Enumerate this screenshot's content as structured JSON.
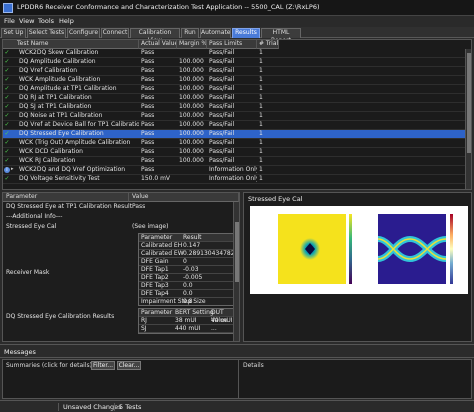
{
  "window": {
    "title": "LPDDR6 Receiver Conformance and Characterization Test Application -- 5500_CAL  (Z:\\RxLP6)"
  },
  "menu": [
    "File",
    "View",
    "Tools",
    "Help"
  ],
  "tabs": [
    {
      "label": "Set Up",
      "active": false
    },
    {
      "label": "Select Tests",
      "active": false
    },
    {
      "label": "Configure",
      "active": false
    },
    {
      "label": "Connect",
      "active": false
    },
    {
      "label": "Calibration View",
      "active": false
    },
    {
      "label": "Run",
      "active": false
    },
    {
      "label": "Automate",
      "active": false
    },
    {
      "label": "Results",
      "active": true
    },
    {
      "label": "HTML Report",
      "active": false
    }
  ],
  "results": {
    "columns": [
      "Test Name",
      "Actual Value",
      "Margin %",
      "Pass Limits",
      "# Trials"
    ],
    "rows": [
      {
        "icon": "check",
        "name": "WCK2DQ Skew Calibration",
        "actual": "Pass",
        "margin": "",
        "limits": "Pass/Fail",
        "trials": "1",
        "selected": false
      },
      {
        "icon": "check",
        "name": "DQ Amplitude Calibration",
        "actual": "Pass",
        "margin": "100.000",
        "limits": "Pass/Fail",
        "trials": "1",
        "selected": false
      },
      {
        "icon": "check",
        "name": "DQ Vref Calibration",
        "actual": "Pass",
        "margin": "100.000",
        "limits": "Pass/Fail",
        "trials": "1",
        "selected": false
      },
      {
        "icon": "check",
        "name": "WCK Amplitude Calibration",
        "actual": "Pass",
        "margin": "100.000",
        "limits": "Pass/Fail",
        "trials": "1",
        "selected": false
      },
      {
        "icon": "check",
        "name": "DQ Amplitude at TP1 Calibration",
        "actual": "Pass",
        "margin": "100.000",
        "limits": "Pass/Fail",
        "trials": "1",
        "selected": false
      },
      {
        "icon": "check",
        "name": "DQ RJ at TP1 Calibration",
        "actual": "Pass",
        "margin": "100.000",
        "limits": "Pass/Fail",
        "trials": "1",
        "selected": false
      },
      {
        "icon": "check",
        "name": "DQ SJ at TP1 Calibration",
        "actual": "Pass",
        "margin": "100.000",
        "limits": "Pass/Fail",
        "trials": "1",
        "selected": false
      },
      {
        "icon": "check",
        "name": "DQ Noise at TP1 Calibration",
        "actual": "Pass",
        "margin": "100.000",
        "limits": "Pass/Fail",
        "trials": "1",
        "selected": false
      },
      {
        "icon": "check",
        "name": "DQ Vref at Device Ball for TP1 Calibration",
        "actual": "Pass",
        "margin": "100.000",
        "limits": "Pass/Fail",
        "trials": "1",
        "selected": false
      },
      {
        "icon": "check",
        "name": "DQ Stressed Eye Calibration",
        "actual": "Pass",
        "margin": "100.000",
        "limits": "Pass/Fail",
        "trials": "1",
        "selected": true
      },
      {
        "icon": "check",
        "name": "WCK (Trig Out) Amplitude Calibration",
        "actual": "Pass",
        "margin": "100.000",
        "limits": "Pass/Fail",
        "trials": "1",
        "selected": false
      },
      {
        "icon": "check",
        "name": "WCK DCD Calibration",
        "actual": "Pass",
        "margin": "100.000",
        "limits": "Pass/Fail",
        "trials": "1",
        "selected": false
      },
      {
        "icon": "check",
        "name": "WCK RJ Calibration",
        "actual": "Pass",
        "margin": "100.000",
        "limits": "Pass/Fail",
        "trials": "1",
        "selected": false
      },
      {
        "icon": "info",
        "name": "WCK2DQ and DQ Vref Optimization",
        "actual": "Pass",
        "margin": "",
        "limits": "Information Only",
        "trials": "1",
        "selected": false,
        "expand": true
      },
      {
        "icon": "check",
        "name": "DQ Voltage Sensitivity Test",
        "actual": "150.0 mV",
        "margin": "",
        "limits": "Information Only",
        "trials": "1",
        "selected": false
      }
    ]
  },
  "params": {
    "columns": [
      "Parameter",
      "Value"
    ],
    "rows": [
      {
        "name": "DQ Stressed Eye at TP1 Calibration Result",
        "value": "Pass"
      },
      {
        "name": "---Additional Info---",
        "value": ""
      },
      {
        "name": "Stressed Eye Cal",
        "value": "(See image)"
      }
    ],
    "receiver_mask_label": "Receiver Mask",
    "mask_table": {
      "header": [
        "Parameter",
        "Result"
      ],
      "rows": [
        [
          "Calibrated EH",
          "0.147"
        ],
        [
          "Calibrated EW",
          "0.28913043478260"
        ],
        [
          "DFE Gain",
          "0"
        ],
        [
          "DFE Tap1",
          "-0.03"
        ],
        [
          "DFE Tap2",
          "-0.005"
        ],
        [
          "DFE Tap3",
          "0.0"
        ],
        [
          "DFE Tap4",
          "0.0"
        ],
        [
          "Impairment Step Size",
          "0.8"
        ]
      ]
    },
    "last_row_label": "DQ Stressed Eye Calibration Results",
    "bert_table": {
      "header": [
        "Parameter",
        "BERT Setting",
        "DUT Value"
      ],
      "rows": [
        [
          "RJ",
          "38 mUI",
          "40 mUI"
        ],
        [
          "SJ",
          "440 mUI",
          "..."
        ]
      ]
    }
  },
  "image_panel": {
    "title": "Stressed Eye Cal"
  },
  "messages": {
    "header": "Messages",
    "summaries_label": "Summaries (click for details)",
    "filter_button": "Filter...",
    "clear_button": "Clear...",
    "details_label": "Details"
  },
  "status": {
    "unsaved": "Unsaved Changes",
    "tests": "5 Tests"
  },
  "colors": {
    "selection": "#2e63c8",
    "pass_check": "#4fd04f",
    "tab_active": "#4a7bd8"
  }
}
